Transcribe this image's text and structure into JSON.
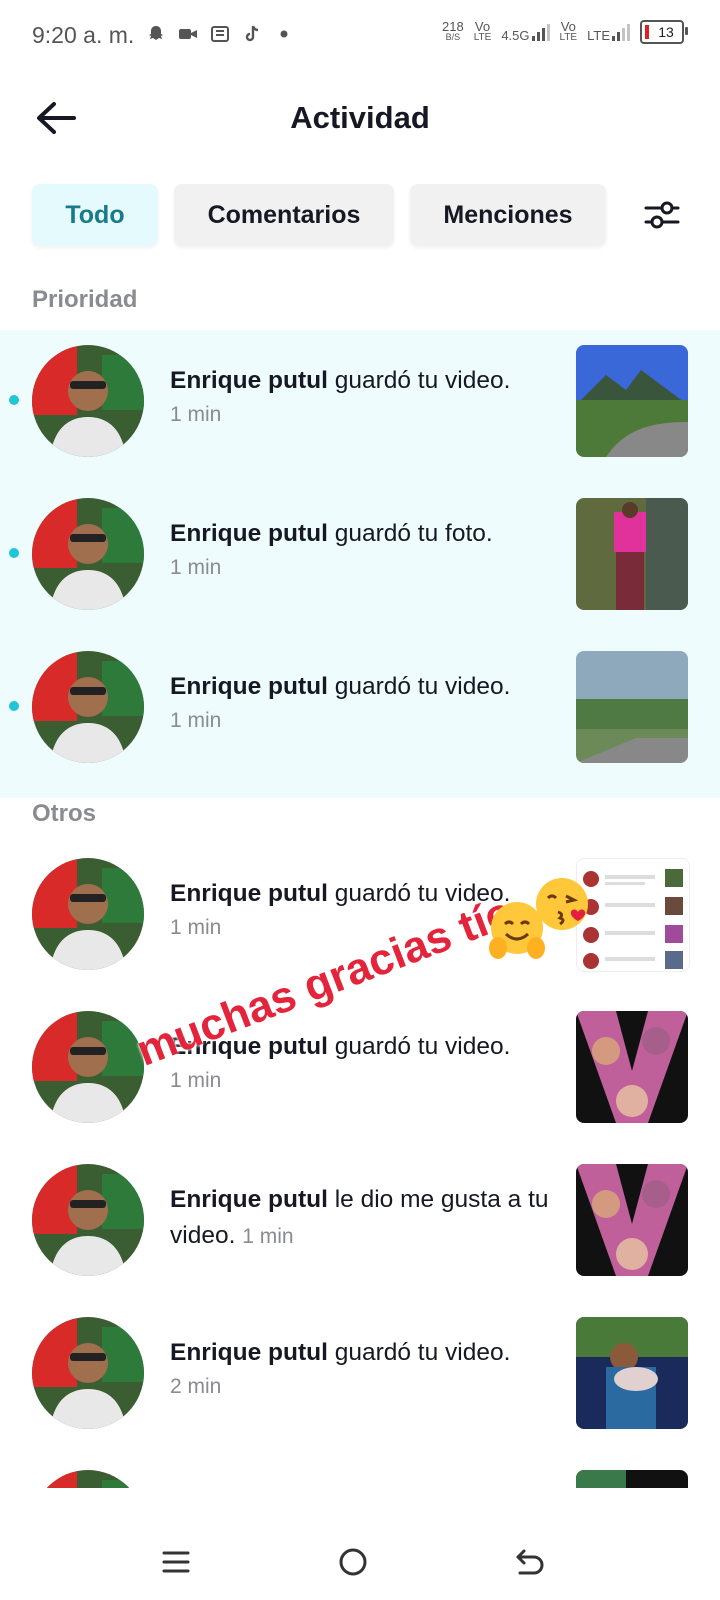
{
  "status_bar": {
    "time": "9:20 a. m.",
    "net_speed_value": "218",
    "net_speed_unit": "B/S",
    "vo_label": "Vo",
    "lte_label": "LTE",
    "sim1_network": "4.5G",
    "sim2_network": "LTE",
    "battery_level": "13"
  },
  "header": {
    "title": "Actividad"
  },
  "tabs": [
    {
      "label": "Todo",
      "active": true
    },
    {
      "label": "Comentarios",
      "active": false
    },
    {
      "label": "Menciones",
      "active": false
    }
  ],
  "sections": {
    "priority": "Prioridad",
    "others": "Otros"
  },
  "notifications": [
    {
      "user": "Enrique putul",
      "action": "guardó tu video.",
      "time": "1 min",
      "unread": true
    },
    {
      "user": "Enrique putul",
      "action": "guardó tu foto.",
      "time": "1 min",
      "unread": true
    },
    {
      "user": "Enrique putul",
      "action": "guardó tu video.",
      "time": "1 min",
      "unread": true
    },
    {
      "user": "Enrique putul",
      "action": "guardó tu video.",
      "time": "1 min",
      "unread": false
    },
    {
      "user": "Enrique putul",
      "action": "guardó tu video.",
      "time": "1 min",
      "unread": false
    },
    {
      "user": "Enrique putul",
      "action": "le dio me gusta a tu video.",
      "time": "1 min",
      "unread": false
    },
    {
      "user": "Enrique putul",
      "action": "guardó tu video.",
      "time": "2 min",
      "unread": false
    }
  ],
  "overlay": {
    "caption": "muchas gracias tío"
  },
  "colors": {
    "accent": "#20c5d8",
    "active_tab_bg": "#e5fafd",
    "active_tab_text": "#187a8a",
    "priority_bg": "#effcfd",
    "overlay_red": "#e3243b"
  }
}
